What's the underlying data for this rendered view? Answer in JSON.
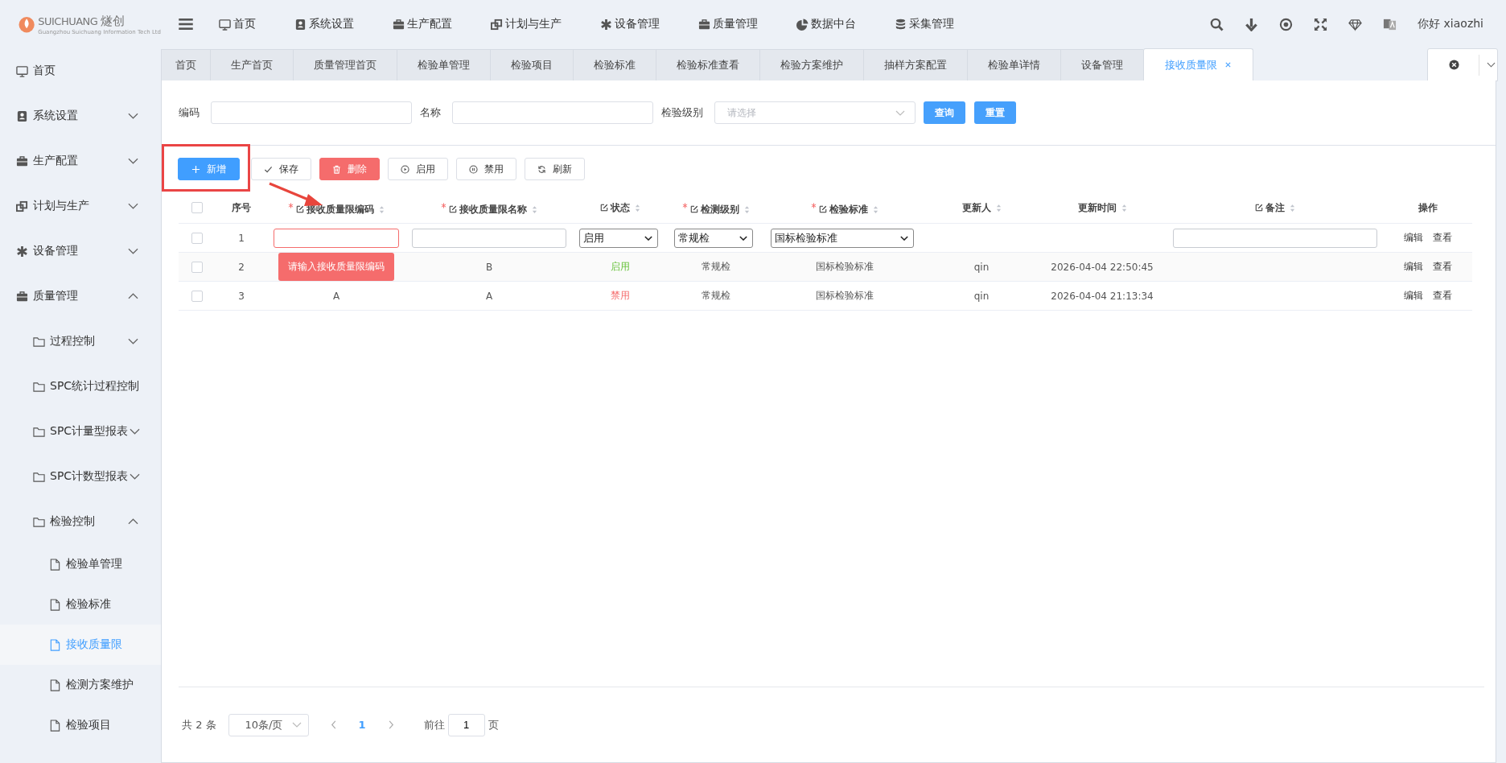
{
  "header": {
    "logo": {
      "brand": "SUICHUANG",
      "brand_cn": "燧创",
      "tagline": "Guangzhou Suichuang Information Tech Ltd"
    },
    "nav": [
      {
        "label": "首页"
      },
      {
        "label": "系统设置"
      },
      {
        "label": "生产配置"
      },
      {
        "label": "计划与生产"
      },
      {
        "label": "设备管理"
      },
      {
        "label": "质量管理"
      },
      {
        "label": "数据中台"
      },
      {
        "label": "采集管理"
      }
    ],
    "greeting": "你好 xiaozhi"
  },
  "sidebar": {
    "items": [
      {
        "label": "首页",
        "kind": "top"
      },
      {
        "label": "系统设置",
        "kind": "top",
        "expanded": false
      },
      {
        "label": "生产配置",
        "kind": "top",
        "expanded": false
      },
      {
        "label": "计划与生产",
        "kind": "top",
        "expanded": false
      },
      {
        "label": "设备管理",
        "kind": "top",
        "expanded": false
      },
      {
        "label": "质量管理",
        "kind": "top",
        "expanded": true,
        "children": [
          {
            "label": "过程控制",
            "kind": "folder",
            "expanded": false
          },
          {
            "label": "SPC统计过程控制",
            "kind": "folder"
          },
          {
            "label": "SPC计量型报表",
            "kind": "folder",
            "expanded": false
          },
          {
            "label": "SPC计数型报表",
            "kind": "folder",
            "expanded": false
          },
          {
            "label": "检验控制",
            "kind": "folder",
            "expanded": true,
            "children": [
              {
                "label": "检验单管理",
                "kind": "file",
                "selected": false
              },
              {
                "label": "检验标准",
                "kind": "file",
                "selected": false
              },
              {
                "label": "接收质量限",
                "kind": "file",
                "selected": true
              },
              {
                "label": "检测方案维护",
                "kind": "file",
                "selected": false
              },
              {
                "label": "检验项目",
                "kind": "file",
                "selected": false
              }
            ]
          }
        ]
      }
    ]
  },
  "tabs": [
    {
      "label": "首页",
      "selected": false
    },
    {
      "label": "生产首页",
      "selected": false
    },
    {
      "label": "质量管理首页",
      "selected": false
    },
    {
      "label": "检验单管理",
      "selected": false
    },
    {
      "label": "检验项目",
      "selected": false
    },
    {
      "label": "检验标准",
      "selected": false
    },
    {
      "label": "检验标准查看",
      "selected": false
    },
    {
      "label": "检验方案维护",
      "selected": false
    },
    {
      "label": "抽样方案配置",
      "selected": false
    },
    {
      "label": "检验单详情",
      "selected": false
    },
    {
      "label": "设备管理",
      "selected": false
    },
    {
      "label": "接收质量限",
      "selected": true
    }
  ],
  "filters": {
    "fields": [
      {
        "label": "编码",
        "kind": "input"
      },
      {
        "label": "名称",
        "kind": "input"
      },
      {
        "label": "检验级别",
        "kind": "select",
        "placeholder": "请选择"
      }
    ],
    "buttons": [
      {
        "label": "查询"
      },
      {
        "label": "重置"
      }
    ]
  },
  "toolbar": [
    {
      "label": "新增",
      "kind": "primary"
    },
    {
      "label": "保存",
      "kind": "plain"
    },
    {
      "label": "删除",
      "kind": "danger"
    },
    {
      "label": "启用",
      "kind": "plain"
    },
    {
      "label": "禁用",
      "kind": "plain"
    },
    {
      "label": "刷新",
      "kind": "plain"
    }
  ],
  "annotation": {
    "highlight": true,
    "arrow": true
  },
  "table": {
    "columns": [
      {
        "kind": "check",
        "checked": false
      },
      {
        "label": "序号",
        "kind": "plain"
      },
      {
        "label": "接收质量限编码",
        "required": true,
        "editable": true,
        "sortable": true
      },
      {
        "label": "接收质量限名称",
        "required": true,
        "editable": true,
        "sortable": true
      },
      {
        "label": "状态",
        "required": false,
        "editable": true,
        "sortable": true
      },
      {
        "label": "检测级别",
        "required": true,
        "editable": true,
        "sortable": true
      },
      {
        "label": "检验标准",
        "required": true,
        "editable": true,
        "sortable": true
      },
      {
        "label": "更新人",
        "required": false,
        "editable": false,
        "sortable": true
      },
      {
        "label": "更新时间",
        "required": false,
        "editable": false,
        "sortable": true
      },
      {
        "label": "备注",
        "required": false,
        "editable": true,
        "sortable": true
      },
      {
        "label": "操作",
        "kind": "plain"
      }
    ],
    "rows": [
      {
        "kind": "edit",
        "checked": false,
        "index": "1",
        "code": {
          "invalid": true,
          "error": "请输入接收质量限编码"
        },
        "status": "启用",
        "level": "常规检",
        "standard": "国标检验标准",
        "actions": [
          "编辑",
          "查看"
        ]
      },
      {
        "kind": "view",
        "checked": false,
        "index": "2",
        "name": "B",
        "status": "启用",
        "enabled": true,
        "level": "常规检",
        "standard": "国标检验标准",
        "updater": "qin",
        "time": "2026-04-04 22:50:45",
        "actions": [
          "编辑",
          "查看"
        ]
      },
      {
        "kind": "view",
        "checked": false,
        "index": "3",
        "code": "A",
        "name": "A",
        "status": "禁用",
        "enabled": false,
        "level": "常规检",
        "standard": "国标检验标准",
        "updater": "qin",
        "time": "2026-04-04 21:13:34",
        "actions": [
          "编辑",
          "查看"
        ]
      }
    ]
  },
  "pagination": {
    "total": "共 2 条",
    "page_size": "10条/页",
    "pages": [
      {
        "label": "1",
        "selected": true
      }
    ],
    "goto_label": "前往",
    "goto_value": "1",
    "goto_suffix": "页"
  }
}
